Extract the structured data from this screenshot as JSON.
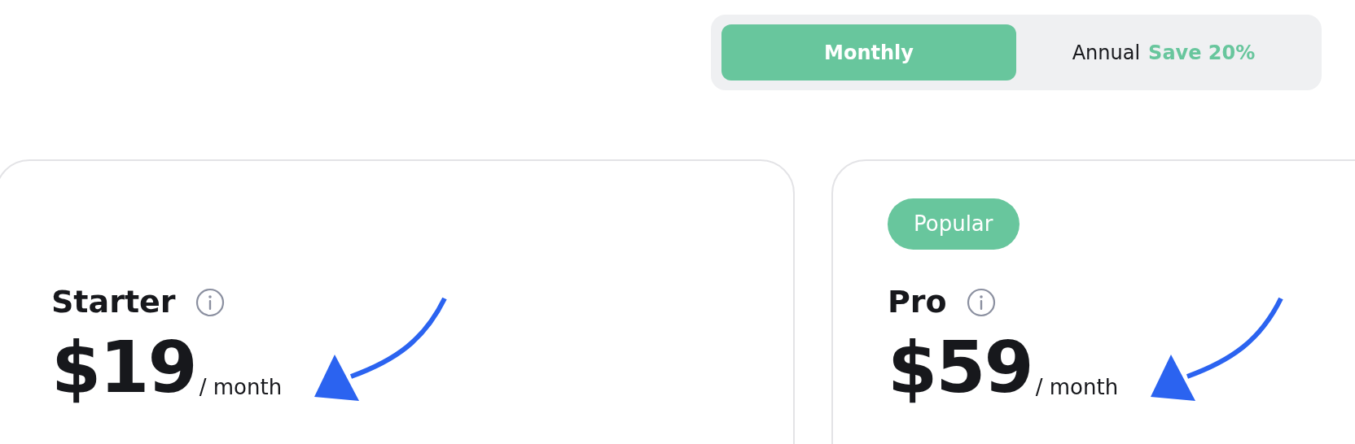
{
  "billing_toggle": [
    {
      "label": "Monthly",
      "selected": true
    },
    {
      "label": "Annual",
      "selected": false,
      "note": "Save 20%"
    }
  ],
  "plans": [
    {
      "name": "Starter",
      "price": "$19",
      "period": "/ month"
    },
    {
      "name": "Pro",
      "badge": "Popular",
      "price": "$59",
      "period": "/ month"
    }
  ]
}
